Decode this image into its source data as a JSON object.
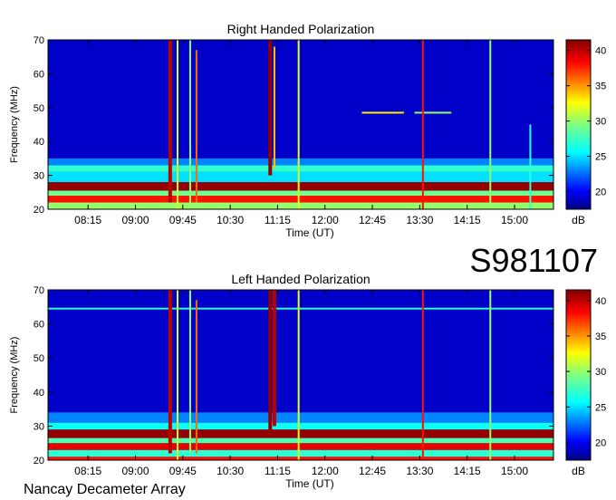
{
  "figure": {
    "observation_id": "S981107",
    "instrument": "Nancay Decameter Array"
  },
  "chart_data": [
    {
      "type": "heatmap",
      "title": "Right Handed Polarization",
      "xlabel": "Time (UT)",
      "ylabel": "Frequency (MHz)",
      "xticks": [
        "08:15",
        "09:00",
        "09:45",
        "10:30",
        "11:15",
        "12:00",
        "12:45",
        "13:30",
        "14:15",
        "15:00"
      ],
      "xlim": [
        "07:37",
        "15:37"
      ],
      "yticks": [
        20,
        30,
        40,
        50,
        60,
        70
      ],
      "ylim": [
        20,
        70
      ],
      "colorbar": {
        "label": "dB",
        "ticks": [
          20,
          25,
          30,
          35,
          40
        ],
        "range": [
          17.5,
          41.5
        ]
      },
      "background_level_db": 19,
      "frequency_bands": [
        {
          "freq_low": 20,
          "freq_high": 22,
          "level_db": 30
        },
        {
          "freq_low": 22,
          "freq_high": 24,
          "level_db": 38
        },
        {
          "freq_low": 24,
          "freq_high": 25.5,
          "level_db": 29
        },
        {
          "freq_low": 25.5,
          "freq_high": 28,
          "level_db": 41
        },
        {
          "freq_low": 28,
          "freq_high": 31,
          "level_db": 25
        },
        {
          "freq_low": 31,
          "freq_high": 33,
          "level_db": 27
        },
        {
          "freq_low": 33,
          "freq_high": 35,
          "level_db": 23
        }
      ],
      "events": [
        {
          "time": "09:33",
          "freq_low": 22,
          "freq_high": 70,
          "level_db": 40
        },
        {
          "time": "09:40",
          "freq_low": 20,
          "freq_high": 70,
          "level_db": 32
        },
        {
          "time": "09:52",
          "freq_low": 22,
          "freq_high": 70,
          "level_db": 30
        },
        {
          "time": "09:58",
          "freq_low": 22,
          "freq_high": 67,
          "level_db": 36
        },
        {
          "time": "11:08",
          "freq_low": 30,
          "freq_high": 70,
          "level_db": 41
        },
        {
          "time": "11:12",
          "freq_low": 32,
          "freq_high": 68,
          "level_db": 34
        },
        {
          "time": "11:35",
          "freq_low": 20,
          "freq_high": 70,
          "level_db": 32
        },
        {
          "time": "13:33",
          "freq_low": 20,
          "freq_high": 70,
          "level_db": 38
        },
        {
          "time": "14:37",
          "freq_low": 20,
          "freq_high": 70,
          "level_db": 30
        },
        {
          "time": "15:15",
          "freq_low": 20,
          "freq_high": 45,
          "level_db": 27
        }
      ],
      "tones": [
        {
          "freq": 48.5,
          "time_start": "12:35",
          "time_end": "13:15",
          "level_db": 33
        },
        {
          "freq": 48.5,
          "time_start": "13:25",
          "time_end": "14:00",
          "level_db": 30
        }
      ]
    },
    {
      "type": "heatmap",
      "title": "Left Handed Polarization",
      "xlabel": "Time (UT)",
      "ylabel": "Frequency (MHz)",
      "xticks": [
        "08:15",
        "09:00",
        "09:45",
        "10:30",
        "11:15",
        "12:00",
        "12:45",
        "13:30",
        "14:15",
        "15:00"
      ],
      "xlim": [
        "07:37",
        "15:37"
      ],
      "yticks": [
        20,
        30,
        40,
        50,
        60,
        70
      ],
      "ylim": [
        20,
        70
      ],
      "colorbar": {
        "label": "dB",
        "ticks": [
          20,
          25,
          30,
          35,
          40
        ],
        "range": [
          17.5,
          41.5
        ]
      },
      "background_level_db": 19,
      "frequency_bands": [
        {
          "freq_low": 20,
          "freq_high": 21,
          "level_db": 38
        },
        {
          "freq_low": 21,
          "freq_high": 23,
          "level_db": 27
        },
        {
          "freq_low": 23,
          "freq_high": 25,
          "level_db": 39
        },
        {
          "freq_low": 25,
          "freq_high": 26.5,
          "level_db": 28
        },
        {
          "freq_low": 26.5,
          "freq_high": 29,
          "level_db": 41
        },
        {
          "freq_low": 29,
          "freq_high": 31,
          "level_db": 26
        },
        {
          "freq_low": 31,
          "freq_high": 34,
          "level_db": 23
        }
      ],
      "events": [
        {
          "time": "09:33",
          "freq_low": 22,
          "freq_high": 70,
          "level_db": 40
        },
        {
          "time": "09:40",
          "freq_low": 20,
          "freq_high": 70,
          "level_db": 32
        },
        {
          "time": "09:52",
          "freq_low": 22,
          "freq_high": 70,
          "level_db": 30
        },
        {
          "time": "09:58",
          "freq_low": 22,
          "freq_high": 67,
          "level_db": 36
        },
        {
          "time": "11:08",
          "freq_low": 28,
          "freq_high": 70,
          "level_db": 41
        },
        {
          "time": "11:12",
          "freq_low": 30,
          "freq_high": 70,
          "level_db": 40
        },
        {
          "time": "11:35",
          "freq_low": 20,
          "freq_high": 70,
          "level_db": 32
        },
        {
          "time": "13:33",
          "freq_low": 20,
          "freq_high": 70,
          "level_db": 38
        },
        {
          "time": "14:37",
          "freq_low": 20,
          "freq_high": 70,
          "level_db": 30
        }
      ],
      "tones": [
        {
          "freq": 64.5,
          "time_start": "07:37",
          "time_end": "15:37",
          "level_db": 27
        }
      ]
    }
  ]
}
